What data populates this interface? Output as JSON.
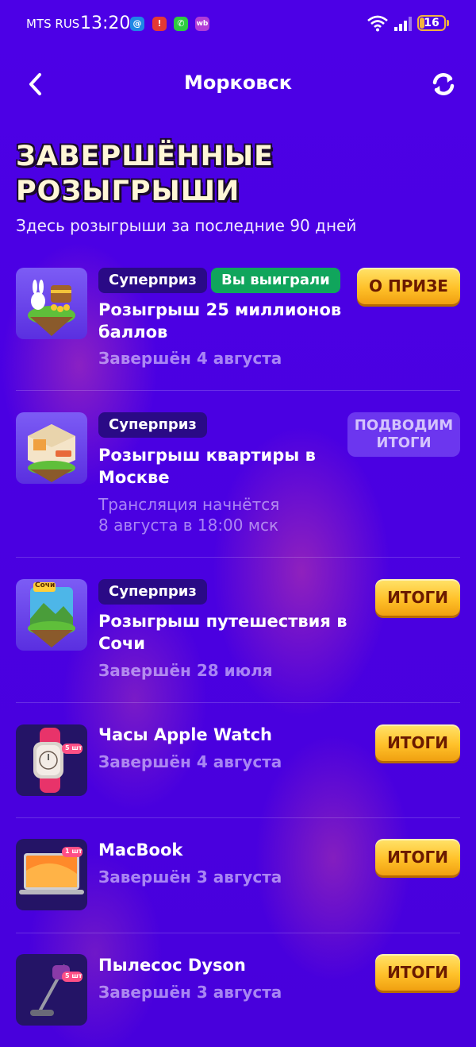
{
  "status_bar": {
    "carrier": "MTS RUS",
    "time": "13:20",
    "battery": "16",
    "notifications": [
      "@",
      "!",
      "✆",
      "wb"
    ]
  },
  "header": {
    "title": "Морковск"
  },
  "page": {
    "title_line1": "ЗАВЕРШЁННЫЕ",
    "title_line2": "РОЗЫГРЫШИ",
    "subtitle": "Здесь розыгрыши за последние 90 дней"
  },
  "draws": [
    {
      "tags": [
        "Суперприз",
        "Вы выиграли"
      ],
      "name": "Розыгрыш 25 миллионов баллов",
      "status": "Завершён 4 августа",
      "button": "О ПРИЗЕ"
    },
    {
      "tags": [
        "Суперприз"
      ],
      "name": "Розыгрыш квартиры в Москве",
      "status_line1": "Трансляция начнётся",
      "status_line2": "8 августа в 18:00 мск",
      "button_line1": "ПОДВОДИМ",
      "button_line2": "ИТОГИ"
    },
    {
      "tags": [
        "Суперприз"
      ],
      "name": "Розыгрыш путешествия в Сочи",
      "status": "Завершён 28 июля",
      "button": "ИТОГИ",
      "thumb_label": "Сочи"
    },
    {
      "name": "Часы Apple Watch",
      "status": "Завершён 4 августа",
      "button": "ИТОГИ",
      "thumb_badge": "5 шт"
    },
    {
      "name": "MacBook",
      "status": "Завершён 3 августа",
      "button": "ИТОГИ",
      "thumb_badge": "1 шт"
    },
    {
      "name": "Пылесос Dyson",
      "status": "Завершён 3 августа",
      "button": "ИТОГИ",
      "thumb_badge": "5 шт"
    }
  ],
  "colors": {
    "background": "#4a00e0",
    "tag_superprize": "#2a0a86",
    "tag_won": "#10a55c",
    "button_gold": "#ffc12a"
  }
}
